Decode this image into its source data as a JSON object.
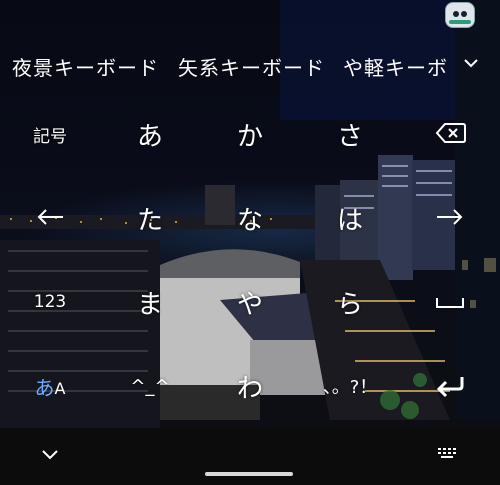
{
  "suggestions": [
    "夜景キーボード",
    "矢系キーボード",
    "や軽キーボ"
  ],
  "keys": {
    "symbols": "記号",
    "a": "あ",
    "ka": "か",
    "sa": "さ",
    "ta": "た",
    "na": "な",
    "ha": "は",
    "num": "123",
    "ma": "ま",
    "ya": "や",
    "ra": "ら",
    "mode_a": "あ",
    "mode_A": "A",
    "dakuten": "^_^",
    "wa": "わ",
    "punct": "、。?！"
  },
  "colors": {
    "mode_accent": "#6fa8ff",
    "key_text": "#ffffff"
  },
  "icons": {
    "backspace": "backspace-icon",
    "left": "arrow-left-icon",
    "right": "arrow-right-icon",
    "space": "space-icon",
    "enter": "enter-icon",
    "collapse": "chevron-down-icon",
    "keyboard": "keyboard-icon"
  }
}
